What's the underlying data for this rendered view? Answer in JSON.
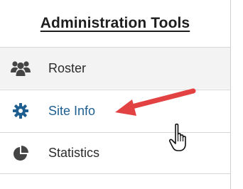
{
  "panel": {
    "title": "Administration Tools"
  },
  "items": [
    {
      "label": "Roster",
      "icon": "users-icon"
    },
    {
      "label": "Site Info",
      "icon": "gear-icon"
    },
    {
      "label": "Statistics",
      "icon": "pie-chart-icon"
    }
  ],
  "colors": {
    "icon": "#454545",
    "link_icon": "#1f5f8f",
    "link_text": "#1f5f8f",
    "arrow": "#e34242",
    "alt_row": "#f3f3f3"
  }
}
